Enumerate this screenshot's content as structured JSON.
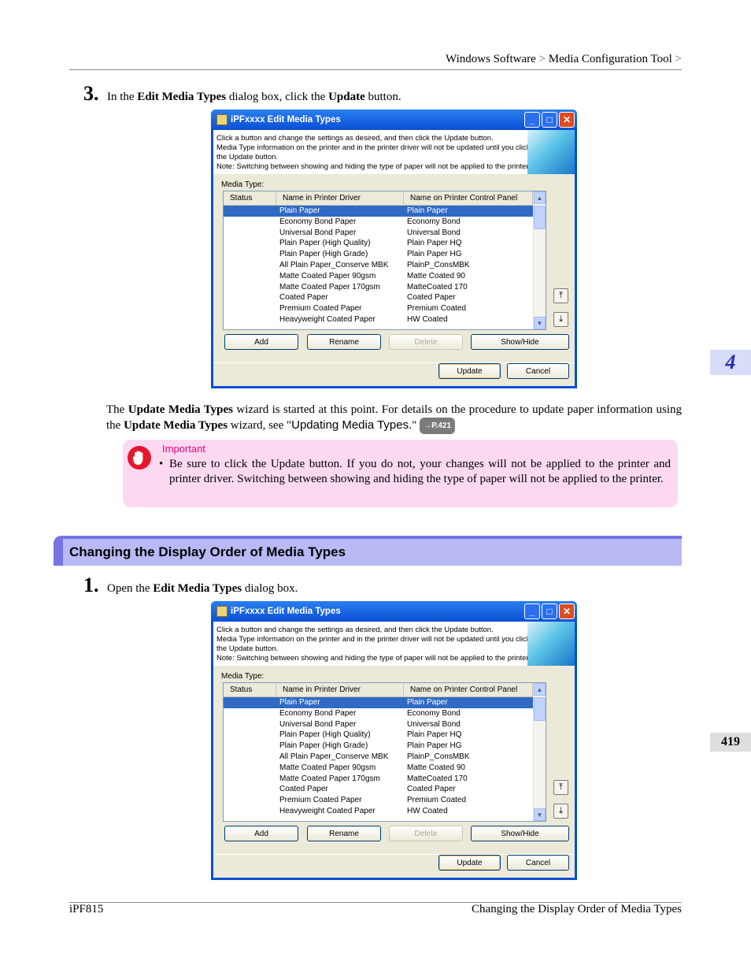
{
  "header": {
    "crumb1": "Windows Software",
    "crumb2": "Media Configuration Tool",
    "sep": ">"
  },
  "step3": {
    "num": "3.",
    "pre": "In the ",
    "bold1": "Edit Media Types",
    "mid": " dialog box, click the ",
    "bold2": "Update",
    "post": " button."
  },
  "para": {
    "t1": "The ",
    "b1": "Update Media Types",
    "t2": " wizard is started at this point. For details on the procedure to update paper information using the ",
    "b2": "Update Media Types",
    "t3": " wizard, see \"",
    "link": "Updating Media Types.",
    "t4": "\" ",
    "ref": "→P.421"
  },
  "important": {
    "title": "Important",
    "bullet": "•",
    "text": "Be sure to click the Update button. If you do not, your changes will not be applied to the printer and printer driver. Switching between showing and hiding the type of paper will not be applied to the printer."
  },
  "section": {
    "title": "Changing the Display Order of Media Types"
  },
  "step1": {
    "num": "1.",
    "pre": "Open the ",
    "bold1": "Edit Media Types",
    "post": " dialog box."
  },
  "dialog": {
    "title": "iPFxxxx Edit Media Types",
    "info_lines": [
      "Click a button and change the settings as desired, and then click the Update button.",
      "Media Type information on the printer and in the printer driver will not be updated until you click",
      "the Update button.",
      "Note: Switching between showing and hiding the type of paper will not be applied to the printer."
    ],
    "media_type_label": "Media Type:",
    "columns": [
      "Status",
      "Name in Printer Driver",
      "Name on Printer Control Panel"
    ],
    "rows": [
      [
        "",
        "Plain Paper",
        "Plain Paper"
      ],
      [
        "",
        "Economy Bond Paper",
        "Economy Bond"
      ],
      [
        "",
        "Universal Bond Paper",
        "Universal Bond"
      ],
      [
        "",
        "Plain Paper (High Quality)",
        "Plain Paper HQ"
      ],
      [
        "",
        "Plain Paper (High Grade)",
        "Plain Paper HG"
      ],
      [
        "",
        "All Plain Paper_Conserve MBK",
        "PlainP_ConsMBK"
      ],
      [
        "",
        "Matte Coated Paper 90gsm",
        "Matte Coated 90"
      ],
      [
        "",
        "Matte Coated Paper 170gsm",
        "MatteCoated 170"
      ],
      [
        "",
        "Coated Paper",
        "Coated Paper"
      ],
      [
        "",
        "Premium Coated Paper",
        "Premium Coated"
      ],
      [
        "",
        "Heavyweight Coated Paper",
        "HW Coated"
      ]
    ],
    "selected_row": 0,
    "buttons": {
      "add": "Add",
      "rename": "Rename",
      "delete": "Delete",
      "showhide": "Show/Hide",
      "update": "Update",
      "cancel": "Cancel"
    }
  },
  "side": {
    "chapter": "4",
    "page": "419"
  },
  "footer": {
    "left": "iPF815",
    "right": "Changing the Display Order of Media Types"
  }
}
